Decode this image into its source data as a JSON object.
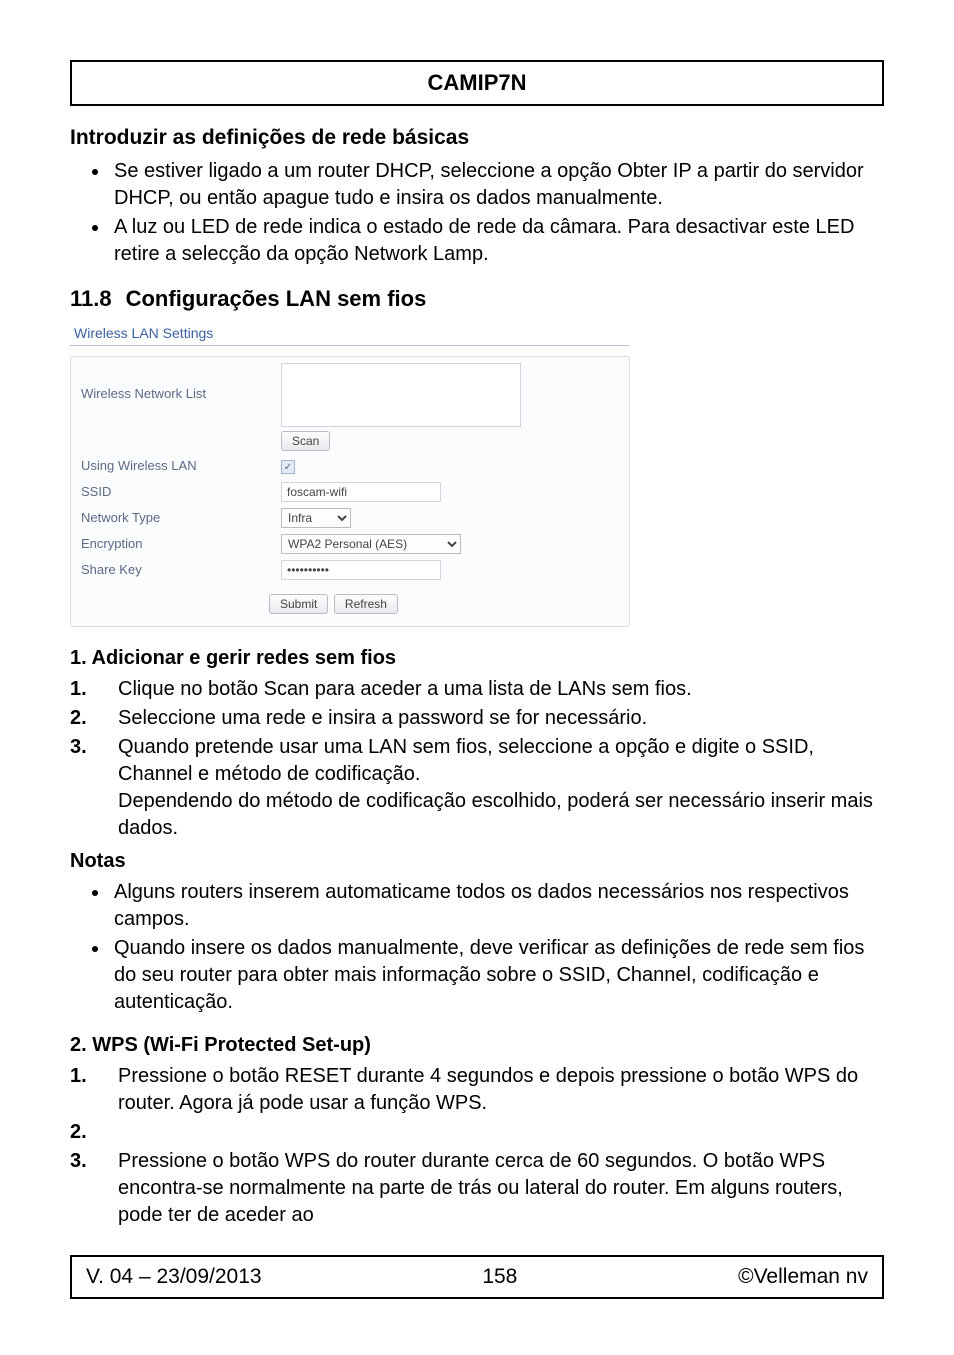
{
  "header": "CAMIP7N",
  "intro_heading": "Introduzir as definições de rede básicas",
  "intro_bullets": [
    "Se estiver ligado a um router DHCP, seleccione a opção Obter IP a partir do servidor DHCP, ou então apague tudo e insira os dados manualmente.",
    "A luz ou LED de rede indica o estado de rede da câmara. Para desactivar este LED retire a selecção da opção Network Lamp."
  ],
  "section_number": "11.8",
  "section_title": "Configurações LAN sem fios",
  "screenshot": {
    "title": "Wireless LAN Settings",
    "labels": {
      "network_list": "Wireless Network List",
      "using_wlan": "Using Wireless LAN",
      "ssid": "SSID",
      "network_type": "Network Type",
      "encryption": "Encryption",
      "share_key": "Share Key"
    },
    "values": {
      "ssid": "foscam-wifi",
      "network_type": "Infra",
      "encryption": "WPA2 Personal (AES)",
      "share_key": "••••••••••"
    },
    "buttons": {
      "scan": "Scan",
      "submit": "Submit",
      "refresh": "Refresh"
    }
  },
  "sub1_heading": "1. Adicionar e gerir redes sem fios",
  "sub1_steps": [
    {
      "n": "1.",
      "t": "Clique no botão Scan para aceder a uma lista de LANs sem fios."
    },
    {
      "n": "2.",
      "t": "Seleccione uma rede e insira a password se for necessário."
    },
    {
      "n": "3.",
      "t": "Quando pretende usar uma LAN sem fios, seleccione a opção e digite o SSID, Channel e método de codificação.\nDependendo do método de codificação escolhido, poderá ser necessário inserir mais dados."
    }
  ],
  "notas_heading": "Notas",
  "notas_bullets": [
    "Alguns routers inserem automaticame todos os dados necessários nos respectivos campos.",
    "Quando insere os dados manualmente, deve verificar as definições de rede sem fios do seu router para obter mais informação sobre o SSID, Channel, codificação e autenticação."
  ],
  "sub2_heading": "2. WPS (Wi-Fi Protected Set-up)",
  "sub2_steps": [
    {
      "n": "1.",
      "t": "Pressione o botão RESET durante 4 segundos e depois pressione o botão WPS do router. Agora já pode usar a função WPS."
    },
    {
      "n": "2.",
      "t": ""
    },
    {
      "n": "3.",
      "t": "Pressione o botão WPS do router durante cerca de 60 segundos. O botão WPS encontra-se normalmente na parte de trás ou lateral do router. Em alguns routers, pode ter de aceder ao"
    }
  ],
  "footer": {
    "left": "V. 04 – 23/09/2013",
    "center": "158",
    "right": "©Velleman nv"
  }
}
